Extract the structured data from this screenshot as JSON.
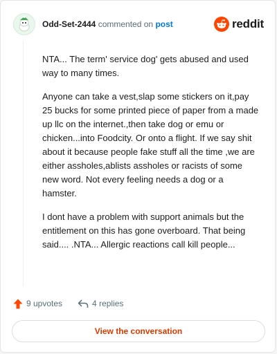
{
  "header": {
    "username": "Odd-Set-2444",
    "action_text": "commented on",
    "post_link": "post",
    "brand": "reddit"
  },
  "comment": {
    "paragraphs": [
      "NTA... The term' service dog' gets abused and used way to many times.",
      "Anyone can take a vest,slap some stickers on it,pay 25 bucks for some printed piece of paper from a made up llc on the internet.,then take dog or emu or chicken...into Foodcity. Or onto a flight. If we say shit about it because people fake stuff all the time ,we are either assholes,ablists assholes or racists of some new word. Not every feeling needs a dog or a hamster.",
      "I dont have a problem with support animals but the entitlement on this has gone overboard. That being said.... .NTA... Allergic reactions call kill people..."
    ]
  },
  "actions": {
    "upvotes": "9 upvotes",
    "replies": "4 replies"
  },
  "cta": {
    "label": "View the conversation"
  },
  "colors": {
    "brand_orange": "#ff4500",
    "cta_text": "#d93a00",
    "link_blue": "#0079d3"
  },
  "icons": {
    "avatar": "snoo-avatar-icon",
    "brand": "reddit-logo-icon",
    "upvote": "upvote-arrow-icon",
    "reply": "reply-arrow-icon"
  }
}
